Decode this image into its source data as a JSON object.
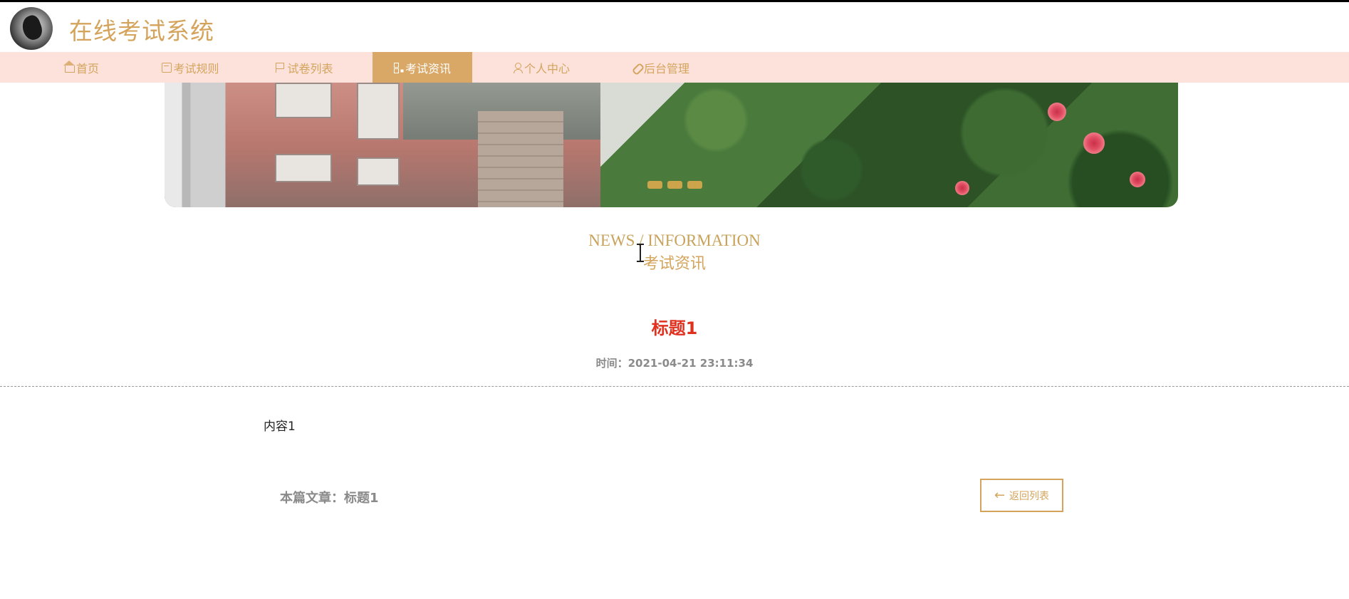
{
  "header": {
    "site_title": "在线考试系统",
    "logo_icon": "bird-logo-icon"
  },
  "nav": {
    "items": [
      {
        "label": "首页",
        "icon": "home-icon"
      },
      {
        "label": "考试规则",
        "icon": "calendar-icon"
      },
      {
        "label": "试卷列表",
        "icon": "flag-icon"
      },
      {
        "label": "考试资讯",
        "icon": "grid-icon",
        "active": true
      },
      {
        "label": "个人中心",
        "icon": "user-icon"
      },
      {
        "label": "后台管理",
        "icon": "link-icon"
      }
    ]
  },
  "banner": {
    "slide_count": 3
  },
  "section": {
    "title_en": "NEWS / INFORMATION",
    "title_cn": "考试资讯"
  },
  "article": {
    "title": "标题1",
    "time": "时间：2021-04-21 23:11:34",
    "content": "内容1",
    "footer_label": "本篇文章：标题1",
    "back_label": "返回列表"
  },
  "colors": {
    "accent": "#d4a45c",
    "nav_bg": "#fde2dc",
    "nav_active_bg": "#d9a867",
    "title_red": "#e0311f"
  }
}
